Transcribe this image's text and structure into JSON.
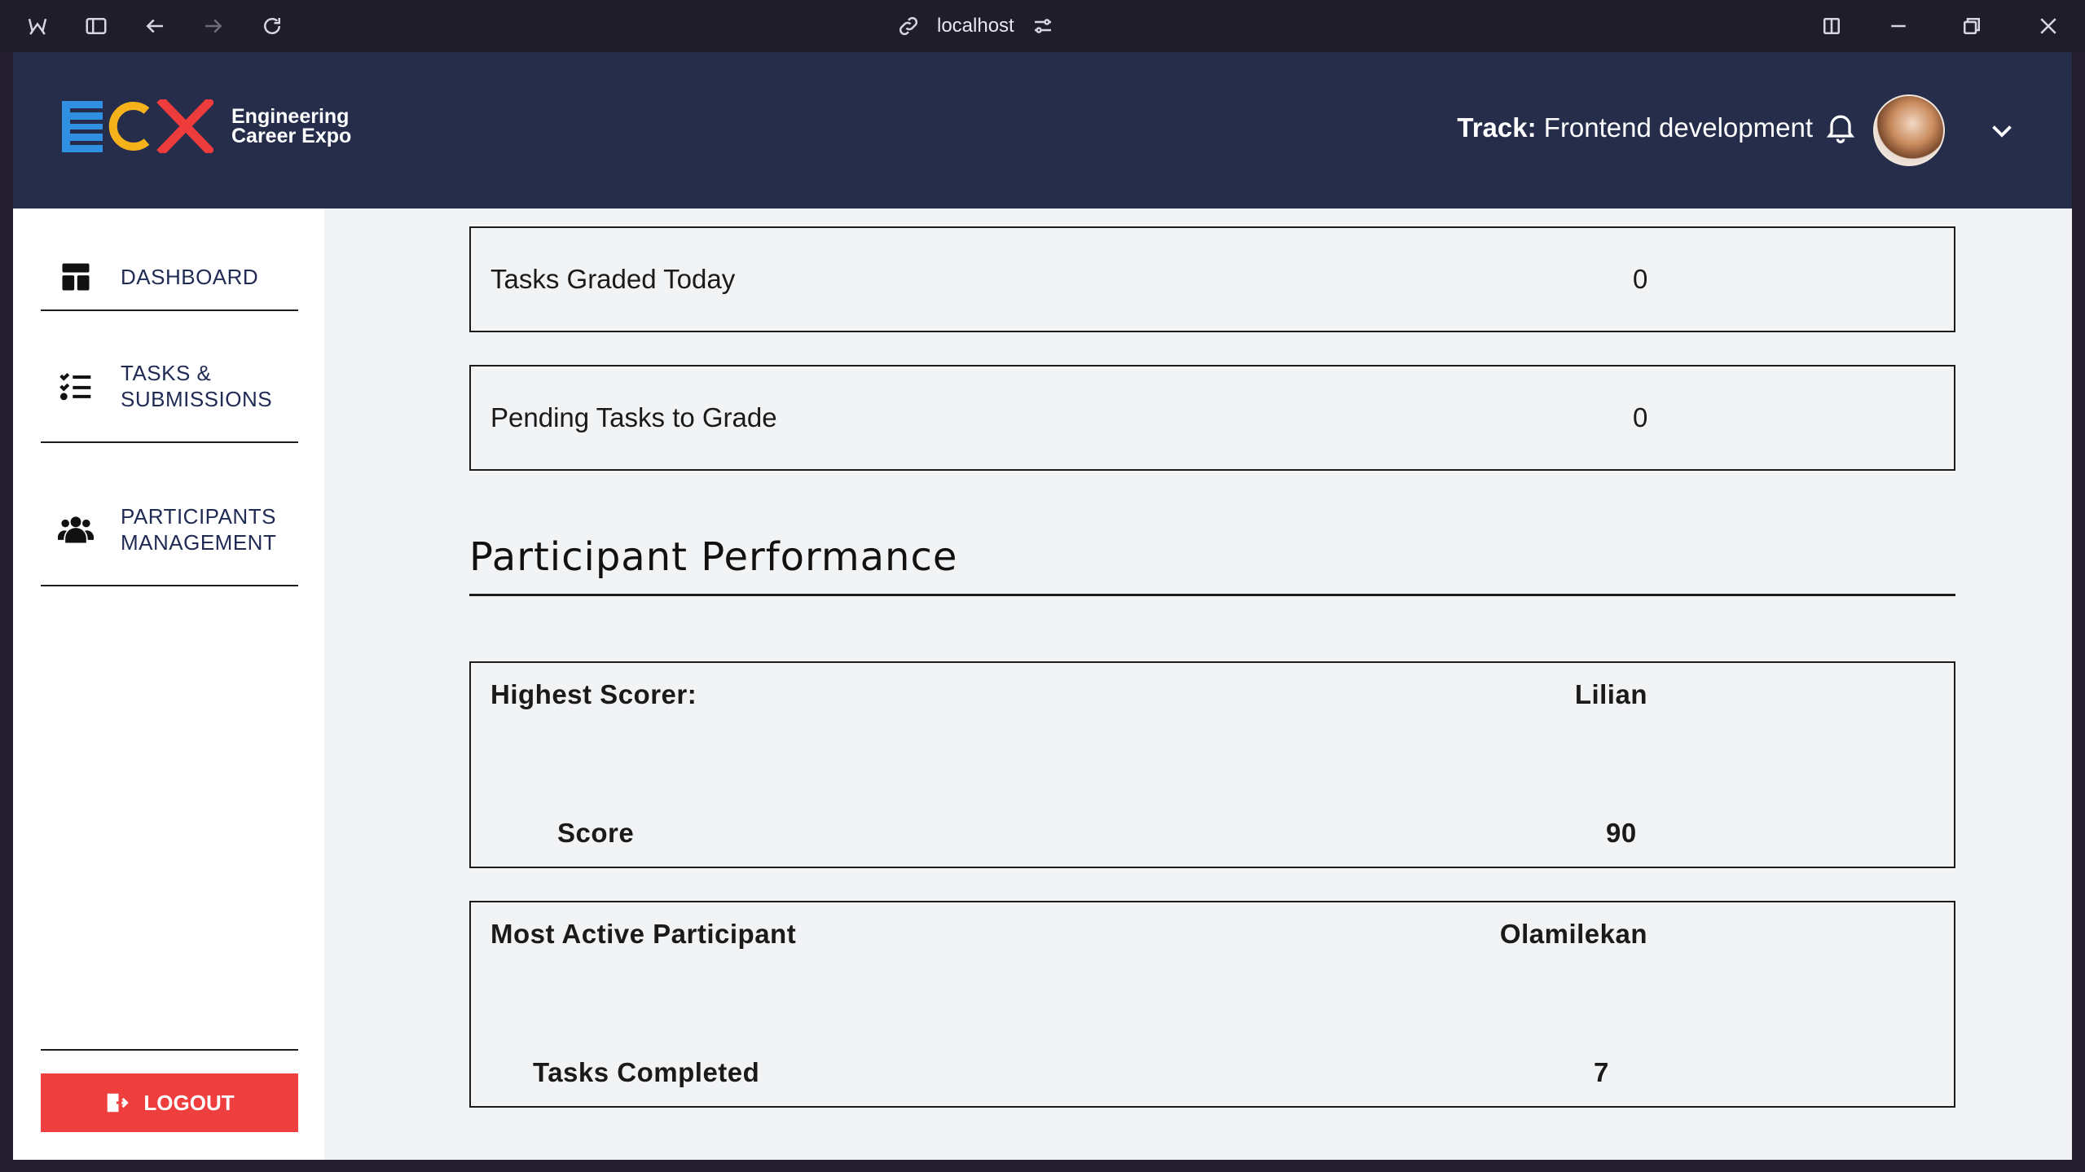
{
  "browser": {
    "url": "localhost"
  },
  "header": {
    "logo_tagline_line1": "Engineering",
    "logo_tagline_line2": "Career Expo",
    "track_label": "Track:",
    "track_value": "Frontend development"
  },
  "sidebar": {
    "items": [
      {
        "label": "DASHBOARD",
        "icon": "dashboard-icon"
      },
      {
        "label": "TASKS &\nSUBMISSIONS",
        "icon": "task-list-icon"
      },
      {
        "label": "PARTICIPANTS\nMANAGEMENT",
        "icon": "users-icon"
      }
    ],
    "logout_label": "LOGOUT"
  },
  "stats": [
    {
      "label": "Tasks Graded Today",
      "value": "0"
    },
    {
      "label": "Pending Tasks to Grade",
      "value": "0"
    }
  ],
  "performance": {
    "title": "Participant Performance",
    "highest_scorer": {
      "label": "Highest Scorer:",
      "name": "Lilian",
      "sub_label": "Score",
      "sub_value": "90"
    },
    "most_active": {
      "label": "Most Active Participant",
      "name": "Olamilekan",
      "sub_label": "Tasks Completed",
      "sub_value": "7"
    }
  },
  "colors": {
    "header_bg": "#252d4b",
    "logout_bg": "#ef3e3e",
    "logo_blue": "#2f8fe0",
    "logo_yellow": "#f5b21b",
    "logo_red": "#ee3b3b"
  }
}
